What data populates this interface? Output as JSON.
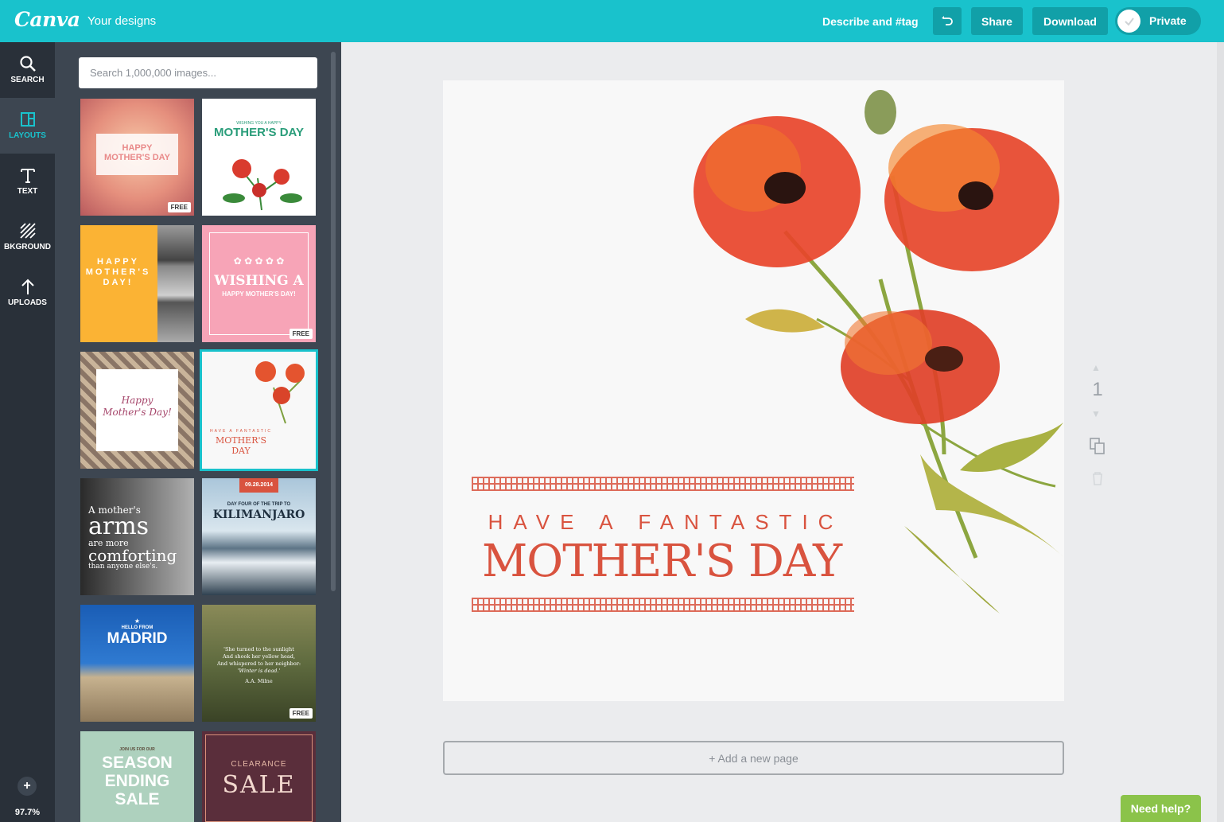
{
  "topbar": {
    "logo": "Canva",
    "your_designs": "Your designs",
    "describe": "Describe and #tag",
    "share": "Share",
    "download": "Download",
    "private": "Private"
  },
  "rail": {
    "items": [
      {
        "label": "SEARCH",
        "icon": "search-icon"
      },
      {
        "label": "LAYOUTS",
        "icon": "layouts-icon"
      },
      {
        "label": "TEXT",
        "icon": "text-icon"
      },
      {
        "label": "BKGROUND",
        "icon": "background-icon"
      },
      {
        "label": "UPLOADS",
        "icon": "upload-icon"
      }
    ],
    "zoom": "97.7%",
    "zoom_in": "+",
    "zoom_out": "−"
  },
  "panel": {
    "search_placeholder": "Search 1,000,000 images...",
    "badge": "FREE",
    "layouts": [
      {
        "lines": [
          "HAPPY",
          "MOTHER'S DAY"
        ]
      },
      {
        "lines": [
          "WISHING YOU A HAPPY",
          "MOTHER'S DAY"
        ]
      },
      {
        "lines": [
          "HAPPY",
          "MOTHER'S",
          "DAY!"
        ]
      },
      {
        "lines": [
          "WISHING A",
          "HAPPY MOTHER'S DAY!"
        ]
      },
      {
        "lines": [
          "Happy",
          "Mother's Day!"
        ]
      },
      {
        "lines": [
          "HAVE A FANTASTIC",
          "MOTHER'S DAY"
        ]
      },
      {
        "lines": [
          "A mother's",
          "arms",
          "are more",
          "comforting",
          "than anyone else's."
        ]
      },
      {
        "lines": [
          "09.28.2014",
          "DAY FOUR OF THE TRIP TO",
          "KILIMANJARO"
        ]
      },
      {
        "lines": [
          "HELLO FROM",
          "MADRID"
        ]
      },
      {
        "lines": [
          "'She turned to the sunlight",
          "And shook her yellow head,",
          "And whispered to her neighbor:",
          "'Winter is dead.'",
          "A.A. Milne"
        ]
      },
      {
        "lines": [
          "JOIN US FOR OUR",
          "SEASON",
          "ENDING",
          "SALE"
        ]
      },
      {
        "lines": [
          "CLEARANCE",
          "SALE"
        ]
      }
    ]
  },
  "canvas": {
    "line1": "HAVE A FANTASTIC",
    "line2": "MOTHER'S DAY",
    "page_number": "1",
    "add_page": "+ Add a new page"
  },
  "help": "Need help?",
  "colors": {
    "accent": "#19c2cc",
    "rail": "#293039",
    "panel": "#3d4651",
    "poppy": "#d9533f",
    "help": "#8bc34a"
  }
}
